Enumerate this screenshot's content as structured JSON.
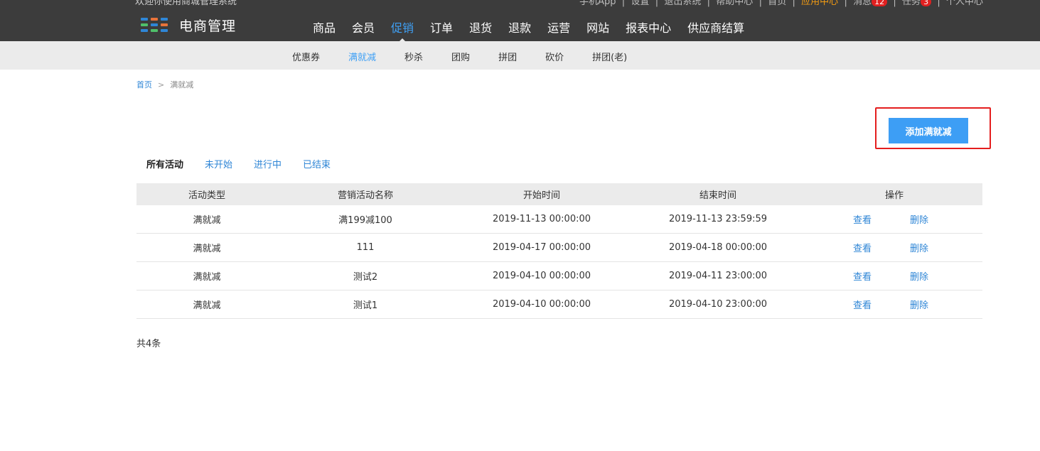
{
  "header": {
    "logo_title": "电商管理",
    "top_cut_left": "欢迎你使用商城管理系统",
    "top_cut_right": {
      "links": [
        "手机App",
        "设置",
        "退出系统",
        "帮助中心",
        "首页"
      ],
      "highlight": "应用中心",
      "messages_label": "消息",
      "messages_count": "12",
      "tasks_label": "任务",
      "tasks_count": "3",
      "tail": "个人中心"
    },
    "nav": [
      {
        "label": "商品"
      },
      {
        "label": "会员"
      },
      {
        "label": "促销"
      },
      {
        "label": "订单"
      },
      {
        "label": "退货"
      },
      {
        "label": "退款"
      },
      {
        "label": "运营"
      },
      {
        "label": "网站"
      },
      {
        "label": "报表中心"
      },
      {
        "label": "供应商结算"
      }
    ],
    "nav_active_index": 2
  },
  "subnav": {
    "items": [
      {
        "label": "优惠券"
      },
      {
        "label": "满就减"
      },
      {
        "label": "秒杀"
      },
      {
        "label": "团购"
      },
      {
        "label": "拼团"
      },
      {
        "label": "砍价"
      },
      {
        "label": "拼团(老)"
      }
    ],
    "active_index": 1
  },
  "breadcrumb": {
    "home": "首页",
    "separator": ">",
    "current": "满就减"
  },
  "add_button_label": "添加满就减",
  "tabs": [
    {
      "label": "所有活动"
    },
    {
      "label": "未开始"
    },
    {
      "label": "进行中"
    },
    {
      "label": "已结束"
    }
  ],
  "tabs_active_index": 0,
  "table": {
    "headers": [
      "活动类型",
      "营销活动名称",
      "开始时间",
      "结束时间",
      "操作"
    ],
    "view_label": "查看",
    "delete_label": "删除",
    "rows": [
      {
        "type": "满就减",
        "name": "满199减100",
        "start": "2019-11-13 00:00:00",
        "end": "2019-11-13 23:59:59"
      },
      {
        "type": "满就减",
        "name": "111",
        "start": "2019-04-17 00:00:00",
        "end": "2019-04-18 00:00:00"
      },
      {
        "type": "满就减",
        "name": "测试2",
        "start": "2019-04-10 00:00:00",
        "end": "2019-04-11 23:00:00"
      },
      {
        "type": "满就减",
        "name": "测试1",
        "start": "2019-04-10 00:00:00",
        "end": "2019-04-10 23:00:00"
      }
    ]
  },
  "total_text": "共4条",
  "colors": {
    "header_bg": "#3c3c3c",
    "accent": "#3d9ef5",
    "link": "#2f86d6",
    "highlight_frame": "#e41e1e",
    "subnav_bg": "#ebebeb"
  }
}
